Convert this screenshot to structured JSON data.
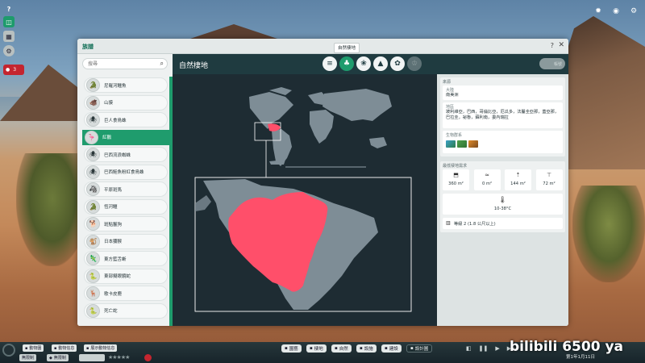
{
  "hud": {
    "help_glyph": "?",
    "notify_count": "3"
  },
  "window": {
    "title": "族譜",
    "tooltip": "自然棲地",
    "help_glyph": "?",
    "close_glyph": "✕"
  },
  "search": {
    "value": "",
    "placeholder": "搜尋"
  },
  "species": [
    {
      "name": "尼羅河鱷魚",
      "icon": "crocodile-icon",
      "glyph": "🐊"
    },
    {
      "name": "山貘",
      "icon": "tapir-icon",
      "glyph": "🐗"
    },
    {
      "name": "巨人食鳥蛛",
      "icon": "spider-icon",
      "glyph": "🕷"
    },
    {
      "name": "紅鸛",
      "icon": "flamingo-icon",
      "glyph": "🦩",
      "selected": true
    },
    {
      "name": "巴西流浪蜘蛛",
      "icon": "spider-icon",
      "glyph": "🕷"
    },
    {
      "name": "巴西鮭魚粉紅食鳥蛛",
      "icon": "spider-icon",
      "glyph": "🕷"
    },
    {
      "name": "平原斑馬",
      "icon": "zebra-icon",
      "glyph": "🦓"
    },
    {
      "name": "恆河鱷",
      "icon": "gharial-icon",
      "glyph": "🐊"
    },
    {
      "name": "斑點鬣狗",
      "icon": "hyena-icon",
      "glyph": "🐕"
    },
    {
      "name": "日本獼猴",
      "icon": "macaque-icon",
      "glyph": "🐒"
    },
    {
      "name": "東方藍舌蜥",
      "icon": "lizard-icon",
      "glyph": "🦎"
    },
    {
      "name": "東部擬眼鏡蛇",
      "icon": "snake-icon",
      "glyph": "🐍"
    },
    {
      "name": "歌卡皮鹿",
      "icon": "deer-icon",
      "glyph": "🦌"
    },
    {
      "name": "死亡蛇",
      "icon": "snake-icon",
      "glyph": "🐍"
    }
  ],
  "header": {
    "title": "自然棲地",
    "user_label": "帳號",
    "tabs": [
      {
        "icon": "document-icon",
        "glyph": "≡"
      },
      {
        "icon": "habitat-tree-icon",
        "glyph": "♣",
        "active": true
      },
      {
        "icon": "food-sack-icon",
        "glyph": "❀"
      },
      {
        "icon": "enrichment-icon",
        "glyph": "▲"
      },
      {
        "icon": "paw-icon",
        "glyph": "✿"
      },
      {
        "icon": "trophy-icon",
        "glyph": "♔",
        "disabled": true
      }
    ]
  },
  "info": {
    "origin_title": "來源",
    "continent_label": "大陸",
    "continent_value": "南美洲",
    "region_label": "地區",
    "region_value": "玻利維亞，巴西，哥倫比亞，厄瓜多，法屬圭亞那，蓋亞那，巴拉圭，祕魯，蘇利南，委內瑞拉",
    "biome_label": "生物群系",
    "habitat_title": "最低棲地需求",
    "stats": [
      {
        "icon": "land-area-icon",
        "glyph": "⬒",
        "value": "360 m²"
      },
      {
        "icon": "water-area-icon",
        "glyph": "≈",
        "value": "0 m²"
      },
      {
        "icon": "climbable-area-icon",
        "glyph": "⇡",
        "value": "144 m²"
      },
      {
        "icon": "height-icon",
        "glyph": "⊤",
        "value": "72 m²"
      }
    ],
    "temperature_icon": "thermometer-icon",
    "temperature": "10-38°C",
    "fence_icon": "fence-icon",
    "fence": "等級 2 (1.8 公尺以上)"
  },
  "bottom": {
    "animal_label": "動物園",
    "animal_info": "動物信息",
    "breeding": "展示動物信息",
    "unlimited1": "無限制",
    "unlimited2": "無限制",
    "center_buttons": [
      "園藝",
      "棲地",
      "自然",
      "設施",
      "建設",
      "設計圖"
    ],
    "date": "第1年1月11日"
  },
  "watermark": "bilibili 6500 ya",
  "colors": {
    "accent": "#1f9c6d",
    "header": "#1f3b40",
    "range": "#ff4f6a",
    "land": "#7e8d96",
    "ocean": "#1e2c33"
  }
}
